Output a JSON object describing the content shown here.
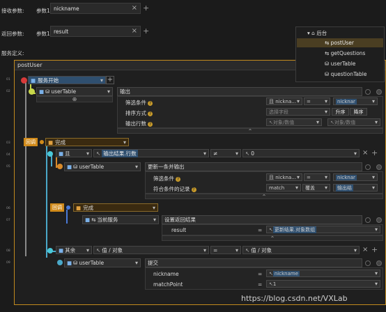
{
  "params": {
    "receive_label": "接收参数:",
    "return_label": "返回参数:",
    "service_def_label": "服务定义:",
    "receive_name": "参数1",
    "receive_value": "nickname",
    "return_name": "参数1",
    "return_value": "result"
  },
  "tree": {
    "root": "后台",
    "items": [
      "postUser",
      "getQuestions",
      "userTable",
      "questionTable"
    ]
  },
  "service": {
    "title": "postUser"
  },
  "gutter": [
    "01",
    "02",
    "03",
    "04",
    "05",
    "06",
    "07",
    "08",
    "09"
  ],
  "s1": {
    "start": "服务开始"
  },
  "s2": {
    "table": "userTable",
    "action": "输出",
    "rows": [
      {
        "label": "筛选条件",
        "left": "且",
        "field": "nickna...",
        "op": "=",
        "value": "nicknar"
      },
      {
        "label": "排序方式",
        "placeholder": "选择字段",
        "asc": "升序",
        "desc": "降序"
      },
      {
        "label": "输出行数",
        "a": "对象/数值",
        "b": "对象/数值"
      }
    ]
  },
  "s3": {
    "callback": "回调",
    "done": "完成"
  },
  "s4": {
    "logic": "且",
    "expr": "输出结果.行数",
    "op": "≠",
    "value": "0"
  },
  "s5": {
    "table": "userTable",
    "action": "更新一条并输出",
    "rows": [
      {
        "label": "筛选条件",
        "left": "且",
        "field": "nickna...",
        "op": "=",
        "value": "nicknar"
      },
      {
        "label": "符合条件的记录",
        "left": "match",
        "mid": "覆盖",
        "value": "输出结"
      }
    ]
  },
  "s6": {
    "callback": "回调",
    "done": "完成"
  },
  "s7": {
    "service": "当前服务",
    "action": "设置返回结果",
    "row_label": "result",
    "row_value": "更新结果.对象数组"
  },
  "s8": {
    "else": "其余",
    "a": "值 / 对象",
    "op": "=",
    "b": "值 / 对象"
  },
  "s9": {
    "table": "userTable",
    "action": "提交",
    "rows": [
      {
        "label": "nickname",
        "op": "=",
        "value": "nickname"
      },
      {
        "label": "matchPoint",
        "op": "=",
        "value": "1"
      }
    ]
  },
  "watermark": "https://blog.csdn.net/VXLab"
}
